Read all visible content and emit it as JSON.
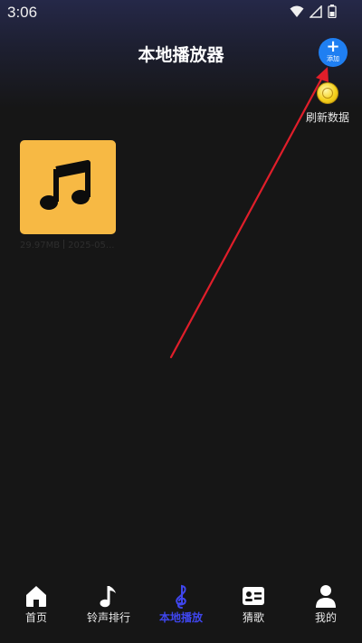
{
  "status_bar": {
    "time": "3:06"
  },
  "header": {
    "title": "本地播放器",
    "add_button": {
      "icon": "plus-icon",
      "symbol": "+",
      "label": "添加"
    },
    "refresh": {
      "icon": "coin-refresh-icon",
      "label": "刷新数据"
    }
  },
  "files": [
    {
      "cover_icon": "music-note-icon",
      "size": "29.97MB",
      "date": "2025-05..."
    }
  ],
  "bottom_nav": {
    "items": [
      {
        "label": "首页",
        "icon": "home-icon",
        "active": false
      },
      {
        "label": "铃声排行",
        "icon": "music-note-icon",
        "active": false
      },
      {
        "label": "本地播放",
        "icon": "treble-clef-icon",
        "active": true
      },
      {
        "label": "猜歌",
        "icon": "id-card-icon",
        "active": false
      },
      {
        "label": "我的",
        "icon": "user-icon",
        "active": false
      }
    ]
  },
  "colors": {
    "background": "#161616",
    "accent_blue": "#1f7ff2",
    "active_nav": "#3f46ee",
    "cover_yellow": "#f7b944",
    "arrow_red": "#e01e2a"
  }
}
